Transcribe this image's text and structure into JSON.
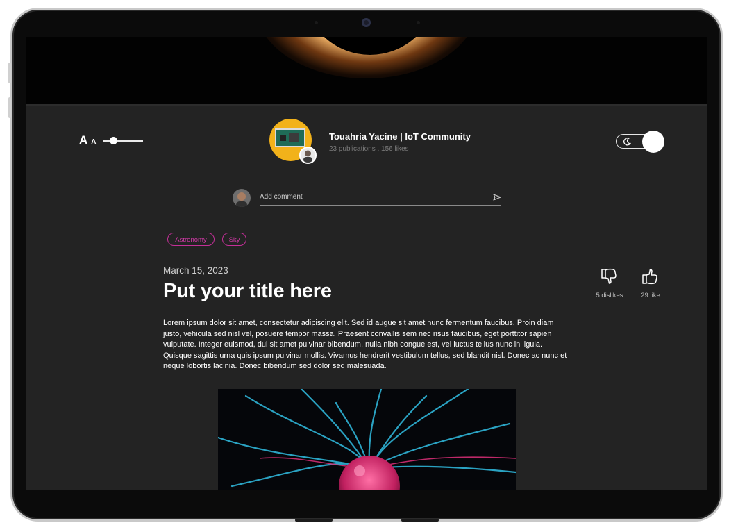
{
  "author": {
    "name": "Touahria Yacine | IoT Community",
    "stats": "23 publications , 156 likes"
  },
  "font_control": {
    "big": "A",
    "small": "A"
  },
  "theme_toggle": {
    "mode": "dark",
    "on": true
  },
  "comment": {
    "placeholder": "Add comment"
  },
  "tags": [
    "Astronomy",
    "Sky"
  ],
  "post": {
    "date": "March 15, 2023",
    "title": "Put your title here",
    "body": "Lorem ipsum dolor sit amet, consectetur adipiscing elit. Sed id augue sit amet nunc fermentum faucibus. Proin diam justo, vehicula sed nisl vel, posuere tempor massa. Praesent convallis sem nec risus faucibus, eget porttitor sapien vulputate. Integer euismod, dui sit amet pulvinar bibendum, nulla nibh congue est, vel luctus tellus nunc in ligula. Quisque sagittis urna quis ipsum pulvinar mollis. Vivamus hendrerit vestibulum tellus, sed blandit nisl. Donec ac nunc et neque lobortis lacinia. Donec bibendum sed dolor sed malesuada."
  },
  "reactions": {
    "dislikes_label": "5 dislikes",
    "likes_label": "29 like"
  },
  "icons": {
    "dislike": "thumbs-down-icon",
    "like": "thumbs-up-icon",
    "send": "send-icon",
    "moon": "moon-icon"
  },
  "colors": {
    "screen_bg": "#232323",
    "tag_accent": "#d33aa8",
    "text": "#ffffff"
  }
}
